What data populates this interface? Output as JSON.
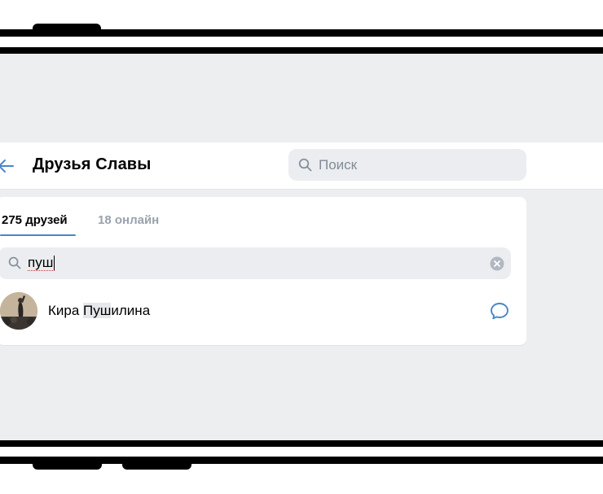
{
  "header": {
    "title": "Друзья Славы",
    "search_placeholder": "Поиск",
    "back_icon": "arrow-left-icon",
    "search_icon": "search-icon"
  },
  "tabs": [
    {
      "label": "275 друзей",
      "active": true
    },
    {
      "label": "18 онлайн",
      "active": false
    }
  ],
  "filter": {
    "value": "пуш",
    "search_icon": "search-icon",
    "clear_icon": "clear-icon"
  },
  "friends": [
    {
      "name_before": "Кира ",
      "name_match": "Пуш",
      "name_after": "илина",
      "action_icon": "message-icon"
    }
  ],
  "colors": {
    "accent": "#4a86c7",
    "background": "#edeef0",
    "field": "#ebedf0",
    "muted_text": "#99a2ad",
    "placeholder": "#818c99"
  }
}
